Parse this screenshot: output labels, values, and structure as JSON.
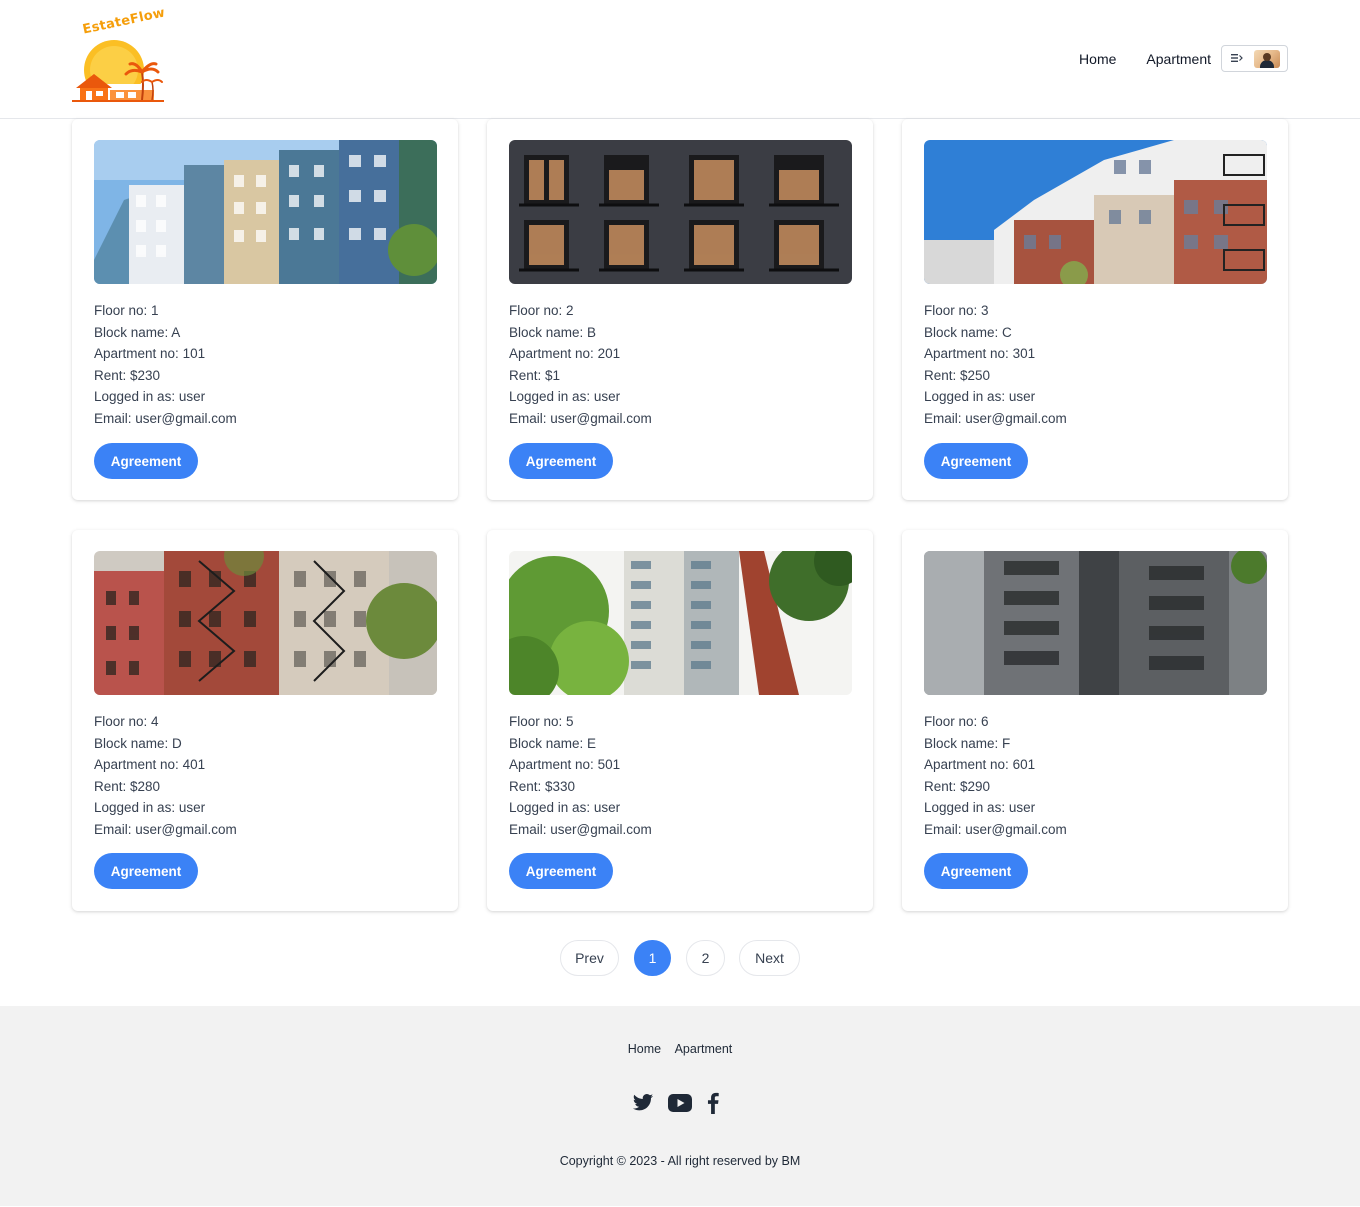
{
  "header": {
    "logo_text": "EstateFlow",
    "nav": {
      "home": "Home",
      "apartment": "Apartment"
    }
  },
  "labels": {
    "floor": "Floor no: ",
    "block": "Block name: ",
    "apartment": "Apartment no: ",
    "rent": "Rent: ",
    "logged": "Logged in as: ",
    "email": "Email: "
  },
  "cards": [
    {
      "floor": "1",
      "block": "A",
      "apartment_no": "101",
      "rent": "$230",
      "logged_in_as": "user",
      "email": "user@gmail.com",
      "button": "Agreement"
    },
    {
      "floor": "2",
      "block": "B",
      "apartment_no": "201",
      "rent": "$1",
      "logged_in_as": "user",
      "email": "user@gmail.com",
      "button": "Agreement"
    },
    {
      "floor": "3",
      "block": "C",
      "apartment_no": "301",
      "rent": "$250",
      "logged_in_as": "user",
      "email": "user@gmail.com",
      "button": "Agreement"
    },
    {
      "floor": "4",
      "block": "D",
      "apartment_no": "401",
      "rent": "$280",
      "logged_in_as": "user",
      "email": "user@gmail.com",
      "button": "Agreement"
    },
    {
      "floor": "5",
      "block": "E",
      "apartment_no": "501",
      "rent": "$330",
      "logged_in_as": "user",
      "email": "user@gmail.com",
      "button": "Agreement"
    },
    {
      "floor": "6",
      "block": "F",
      "apartment_no": "601",
      "rent": "$290",
      "logged_in_as": "user",
      "email": "user@gmail.com",
      "button": "Agreement"
    }
  ],
  "pagination": {
    "prev": "Prev",
    "pages": [
      "1",
      "2"
    ],
    "current": "1",
    "next": "Next"
  },
  "footer": {
    "links": {
      "home": "Home",
      "apartment": "Apartment"
    },
    "social": [
      "twitter-icon",
      "youtube-icon",
      "facebook-icon"
    ],
    "copyright": "Copyright © 2023 - All right reserved by BM"
  },
  "colors": {
    "accent": "#3b82f6",
    "footer_bg": "#f2f2f2",
    "logo_orange": "#f59e0b"
  }
}
